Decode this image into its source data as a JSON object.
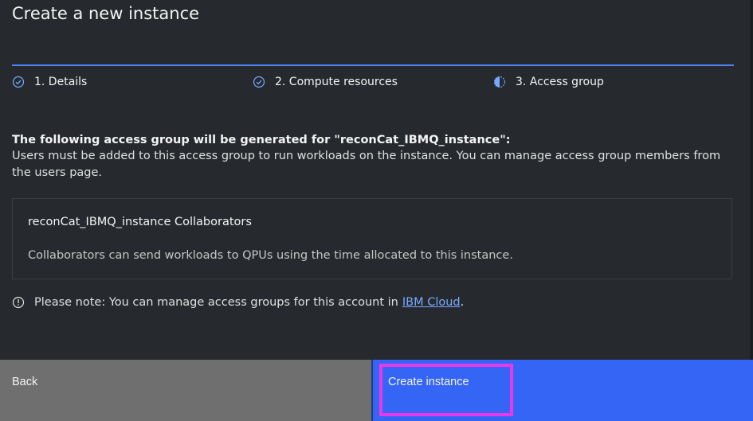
{
  "modal": {
    "title": "Create a new instance"
  },
  "progress": {
    "steps": [
      {
        "label": "1. Details",
        "state": "complete"
      },
      {
        "label": "2. Compute resources",
        "state": "complete"
      },
      {
        "label": "3. Access group",
        "state": "current"
      }
    ]
  },
  "content": {
    "heading": "The following access group will be generated for \"reconCat_IBMQ_instance\":",
    "description": "Users must be added to this access group to run workloads on the instance. You can manage access group members from the users page.",
    "group": {
      "name": "reconCat_IBMQ_instance Collaborators",
      "description": "Collaborators can send workloads to QPUs using the time allocated to this instance."
    },
    "note": {
      "text": "Please note: You can manage access groups for this account in",
      "link_text": "IBM Cloud",
      "suffix": "."
    }
  },
  "footer": {
    "back_label": "Back",
    "create_label": "Create instance"
  },
  "colors": {
    "background": "#262a2e",
    "accent": "#4f82f7",
    "primary_button": "#3565f5",
    "secondary_button": "#6f6f6f",
    "link": "#78a9ff",
    "focus": "#e838e8"
  }
}
